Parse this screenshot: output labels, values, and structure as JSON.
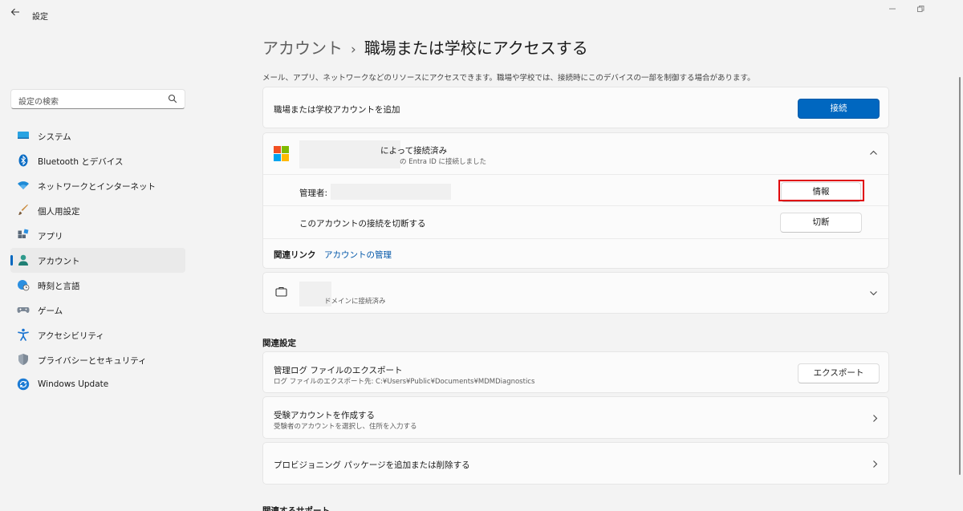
{
  "window": {
    "title": "設定",
    "back_icon": "arrow-left-icon",
    "controls": [
      "minimize-icon",
      "restore-icon"
    ]
  },
  "sidebar": {
    "search_placeholder": "設定の検索",
    "items": [
      {
        "label": "システム",
        "icon": "system-icon"
      },
      {
        "label": "Bluetooth とデバイス",
        "icon": "bluetooth-icon"
      },
      {
        "label": "ネットワークとインターネット",
        "icon": "wifi-icon"
      },
      {
        "label": "個人用設定",
        "icon": "brush-icon"
      },
      {
        "label": "アプリ",
        "icon": "apps-icon"
      },
      {
        "label": "アカウント",
        "icon": "account-icon",
        "selected": true
      },
      {
        "label": "時刻と言語",
        "icon": "globe-clock-icon"
      },
      {
        "label": "ゲーム",
        "icon": "gamepad-icon"
      },
      {
        "label": "アクセシビリティ",
        "icon": "accessibility-icon"
      },
      {
        "label": "プライバシーとセキュリティ",
        "icon": "shield-icon"
      },
      {
        "label": "Windows Update",
        "icon": "update-icon"
      }
    ]
  },
  "main": {
    "breadcrumb_parent": "アカウント",
    "breadcrumb_sep": "›",
    "breadcrumb_current": "職場または学校にアクセスする",
    "description": "メール、アプリ、ネットワークなどのリソースにアクセスできます。職場や学校では、接続時にこのデバイスの一部を制御する場合があります。",
    "add_account": {
      "label": "職場または学校アカウントを追加",
      "button": "接続"
    },
    "account1": {
      "title": "によって接続済み",
      "subtitle": "の Entra ID に接続しました",
      "admin_label": "管理者:",
      "info_button": "情報",
      "disconnect_label": "このアカウントの接続を切断する",
      "disconnect_button": "切断",
      "related_links_label": "関連リンク",
      "manage_link": "アカウントの管理"
    },
    "account2": {
      "subtitle": "ドメインに接続済み"
    },
    "related_settings_heading": "関連設定",
    "export": {
      "title": "管理ログ ファイルのエクスポート",
      "subtitle": "ログ ファイルのエクスポート先: C:¥Users¥Public¥Documents¥MDMDiagnostics",
      "button": "エクスポート"
    },
    "exam": {
      "title": "受験アカウントを作成する",
      "subtitle": "受験者のアカウントを選択し、住所を入力する"
    },
    "provisioning": {
      "title": "プロビジョニング パッケージを追加または削除する"
    },
    "related_support_heading": "関連するサポート"
  },
  "colors": {
    "accent": "#0067c0",
    "highlight": "#e0000a",
    "background": "#f3f3f3"
  }
}
